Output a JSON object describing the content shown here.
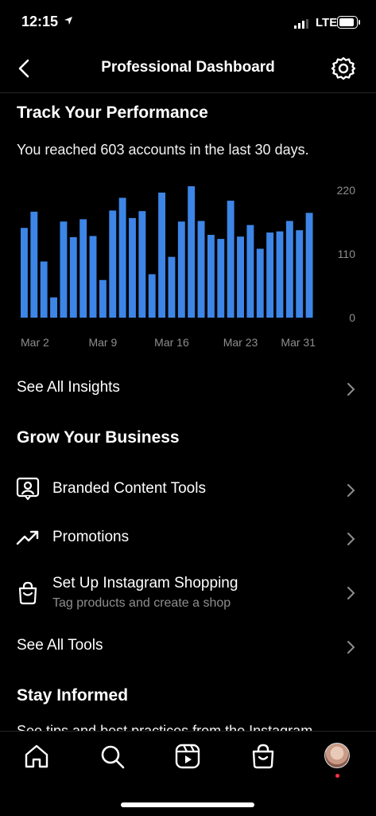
{
  "status": {
    "time": "12:15",
    "network": "LTE"
  },
  "nav": {
    "title": "Professional Dashboard"
  },
  "performance": {
    "heading": "Track Your Performance",
    "reach_text": "You reached 603 accounts in the last 30 days."
  },
  "chart_data": {
    "type": "bar",
    "color": "#3d85e6",
    "x_tick_labels": [
      "Mar 2",
      "Mar 9",
      "Mar 16",
      "Mar 23",
      "Mar 31"
    ],
    "x_tick_indices": [
      1,
      8,
      15,
      22,
      29
    ],
    "y_ticks": [
      {
        "value": 220,
        "label": "220"
      },
      {
        "value": 110,
        "label": "110"
      },
      {
        "value": 0,
        "label": "0"
      }
    ],
    "ylim": [
      0,
      220
    ],
    "values": [
      155,
      183,
      97,
      35,
      166,
      139,
      170,
      141,
      65,
      185,
      207,
      172,
      184,
      75,
      216,
      105,
      166,
      227,
      167,
      143,
      136,
      202,
      140,
      160,
      119,
      147,
      149,
      167,
      151,
      181
    ]
  },
  "insights": {
    "label": "See All Insights"
  },
  "grow": {
    "heading": "Grow Your Business",
    "items": [
      {
        "label": "Branded Content Tools",
        "icon": "branded-content-icon"
      },
      {
        "label": "Promotions",
        "icon": "trending-up-icon"
      },
      {
        "label": "Set Up Instagram Shopping",
        "sublabel": "Tag products and create a shop",
        "icon": "shopping-bag-icon"
      }
    ],
    "see_all": "See All Tools"
  },
  "informed": {
    "heading": "Stay Informed",
    "text": "See tips and best practices from the Instagram"
  },
  "tabs": [
    "home-icon",
    "search-icon",
    "reels-icon",
    "shop-icon",
    "profile-avatar"
  ]
}
